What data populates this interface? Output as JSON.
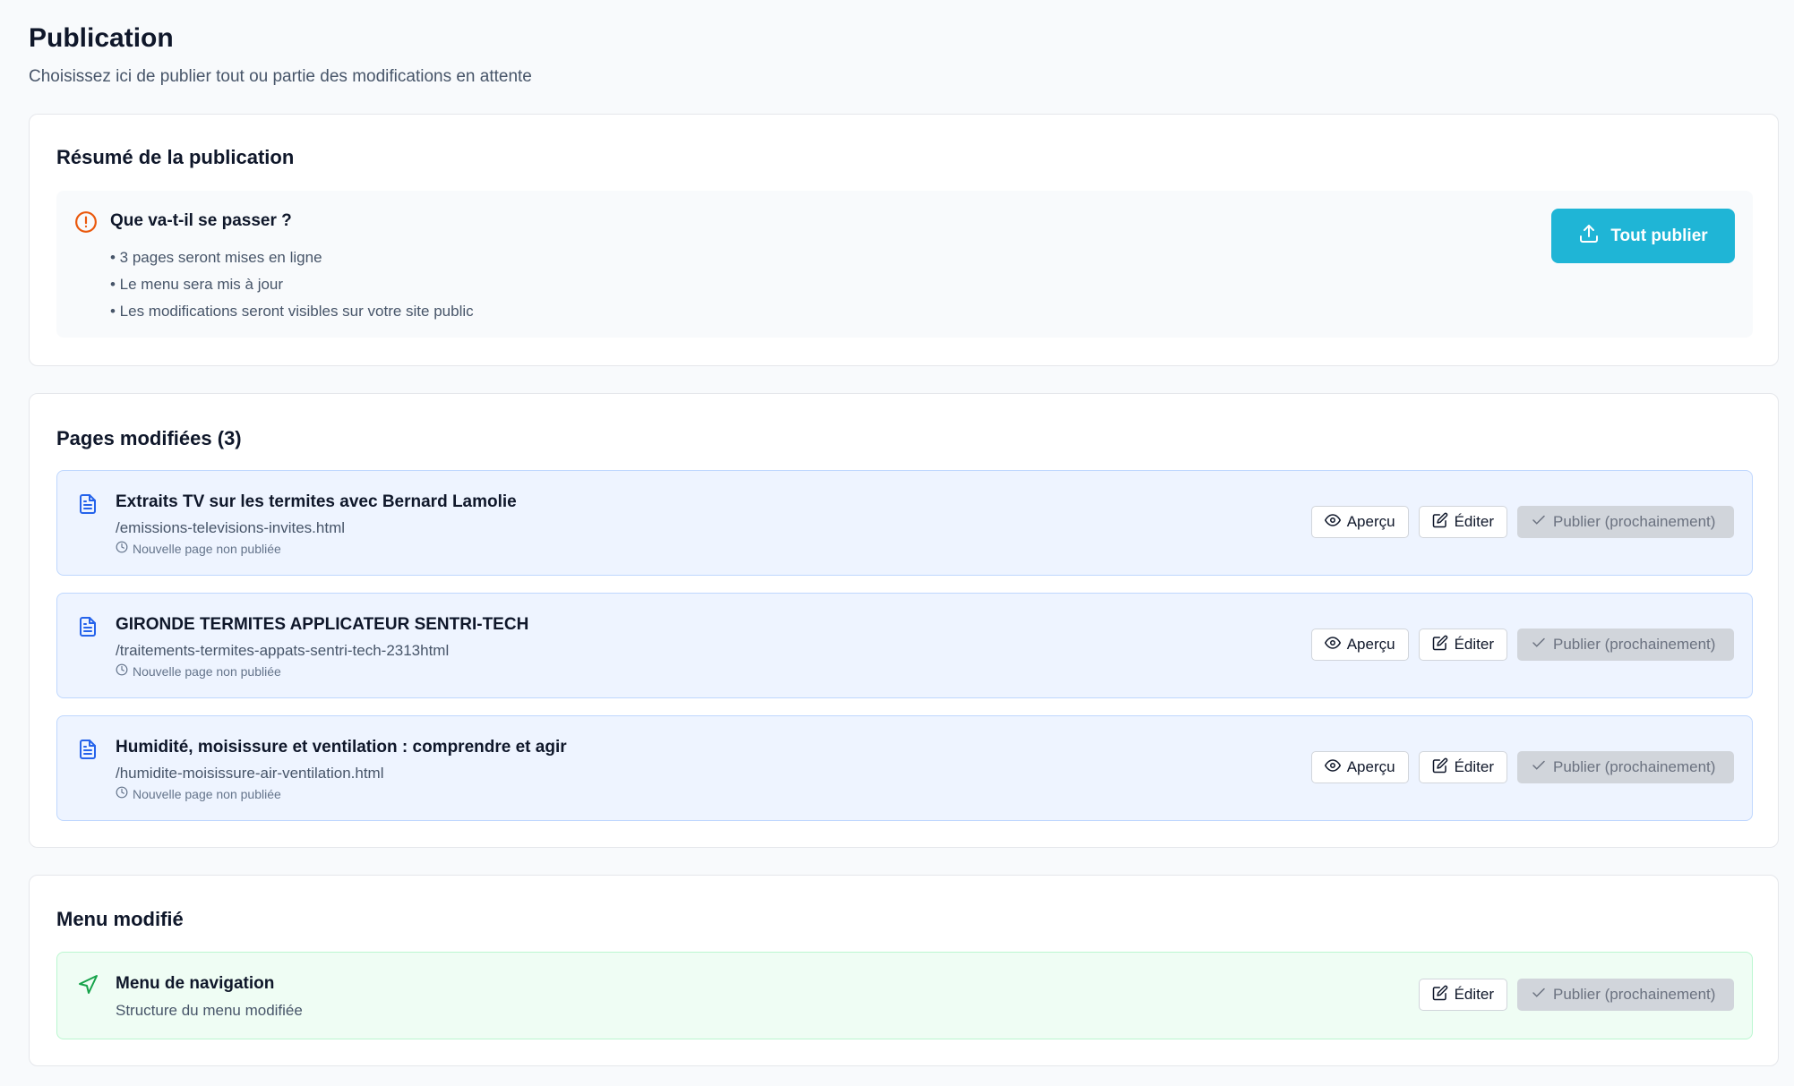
{
  "header": {
    "title": "Publication",
    "subtitle": "Choisissez ici de publier tout ou partie des modifications en attente"
  },
  "summary": {
    "title": "Résumé de la publication",
    "question": "Que va-t-il se passer ?",
    "items": [
      "• 3 pages seront mises en ligne",
      "• Le menu sera mis à jour",
      "• Les modifications seront visibles sur votre site public"
    ],
    "publish_all_label": "Tout publier",
    "accent_color": "#1fb5d6",
    "warning_color": "#ea580c"
  },
  "pages": {
    "title": "Pages modifiées (3)",
    "items": [
      {
        "icon": "file-text-icon",
        "title": "Extraits TV sur les termites avec Bernard Lamolie",
        "path": "/emissions-televisions-invites.html",
        "status": "Nouvelle page non publiée"
      },
      {
        "icon": "file-text-icon",
        "title": "GIRONDE TERMITES APPLICATEUR SENTRI-TECH",
        "path": "/traitements-termites-appats-sentri-tech-2313html",
        "status": "Nouvelle page non publiée"
      },
      {
        "icon": "file-text-icon",
        "title": "Humidité, moisissure et ventilation : comprendre et agir",
        "path": "/humidite-moisissure-air-ventilation.html",
        "status": "Nouvelle page non publiée"
      }
    ]
  },
  "actions": {
    "preview_label": "Aperçu",
    "edit_label": "Éditer",
    "publish_label": "Publier (prochainement)"
  },
  "menu": {
    "title": "Menu modifié",
    "item_title": "Menu de navigation",
    "item_subtitle": "Structure du menu modifiée",
    "icon": "navigation-icon",
    "accent_color": "#16a34a"
  }
}
